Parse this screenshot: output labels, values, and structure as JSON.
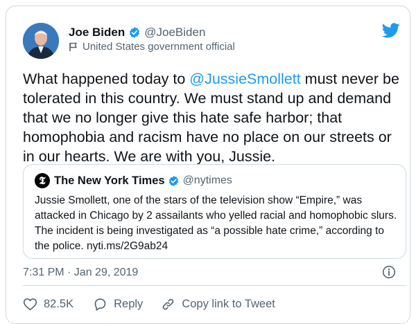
{
  "tweet": {
    "author": {
      "display_name": "Joe Biden",
      "handle": "@JoeBiden",
      "label": "United States government official",
      "verified": true
    },
    "text_before": "What happened today to ",
    "mention": "@JussieSmollett",
    "text_after": " must never be tolerated in this country. We must stand up and demand that we no longer give this hate safe harbor; that homophobia and racism have no place on our streets or in our hearts. We are with you, Jussie.",
    "timestamp": "7:31 PM · Jan 29, 2019",
    "actions": {
      "like_count": "82.5K",
      "reply_label": "Reply",
      "copy_label": "Copy link to Tweet"
    }
  },
  "quote": {
    "display_name": "The New York Times",
    "handle": "@nytimes",
    "verified": true,
    "text": "Jussie Smollett, one of the stars of the television show “Empire,” was attacked in Chicago by 2 assailants who yelled racial and homophobic slurs. The incident is being investigated as “a possible hate crime,” according to the police. nyti.ms/2G9ab24"
  },
  "colors": {
    "accent": "#1d9bf0",
    "secondary_text": "#536471",
    "border": "#cfd9de"
  },
  "icons": [
    "avatar",
    "verified-badge-icon",
    "flag-icon",
    "twitter-bird-icon",
    "nyt-logo-icon",
    "info-icon",
    "heart-icon",
    "reply-icon",
    "link-icon"
  ]
}
